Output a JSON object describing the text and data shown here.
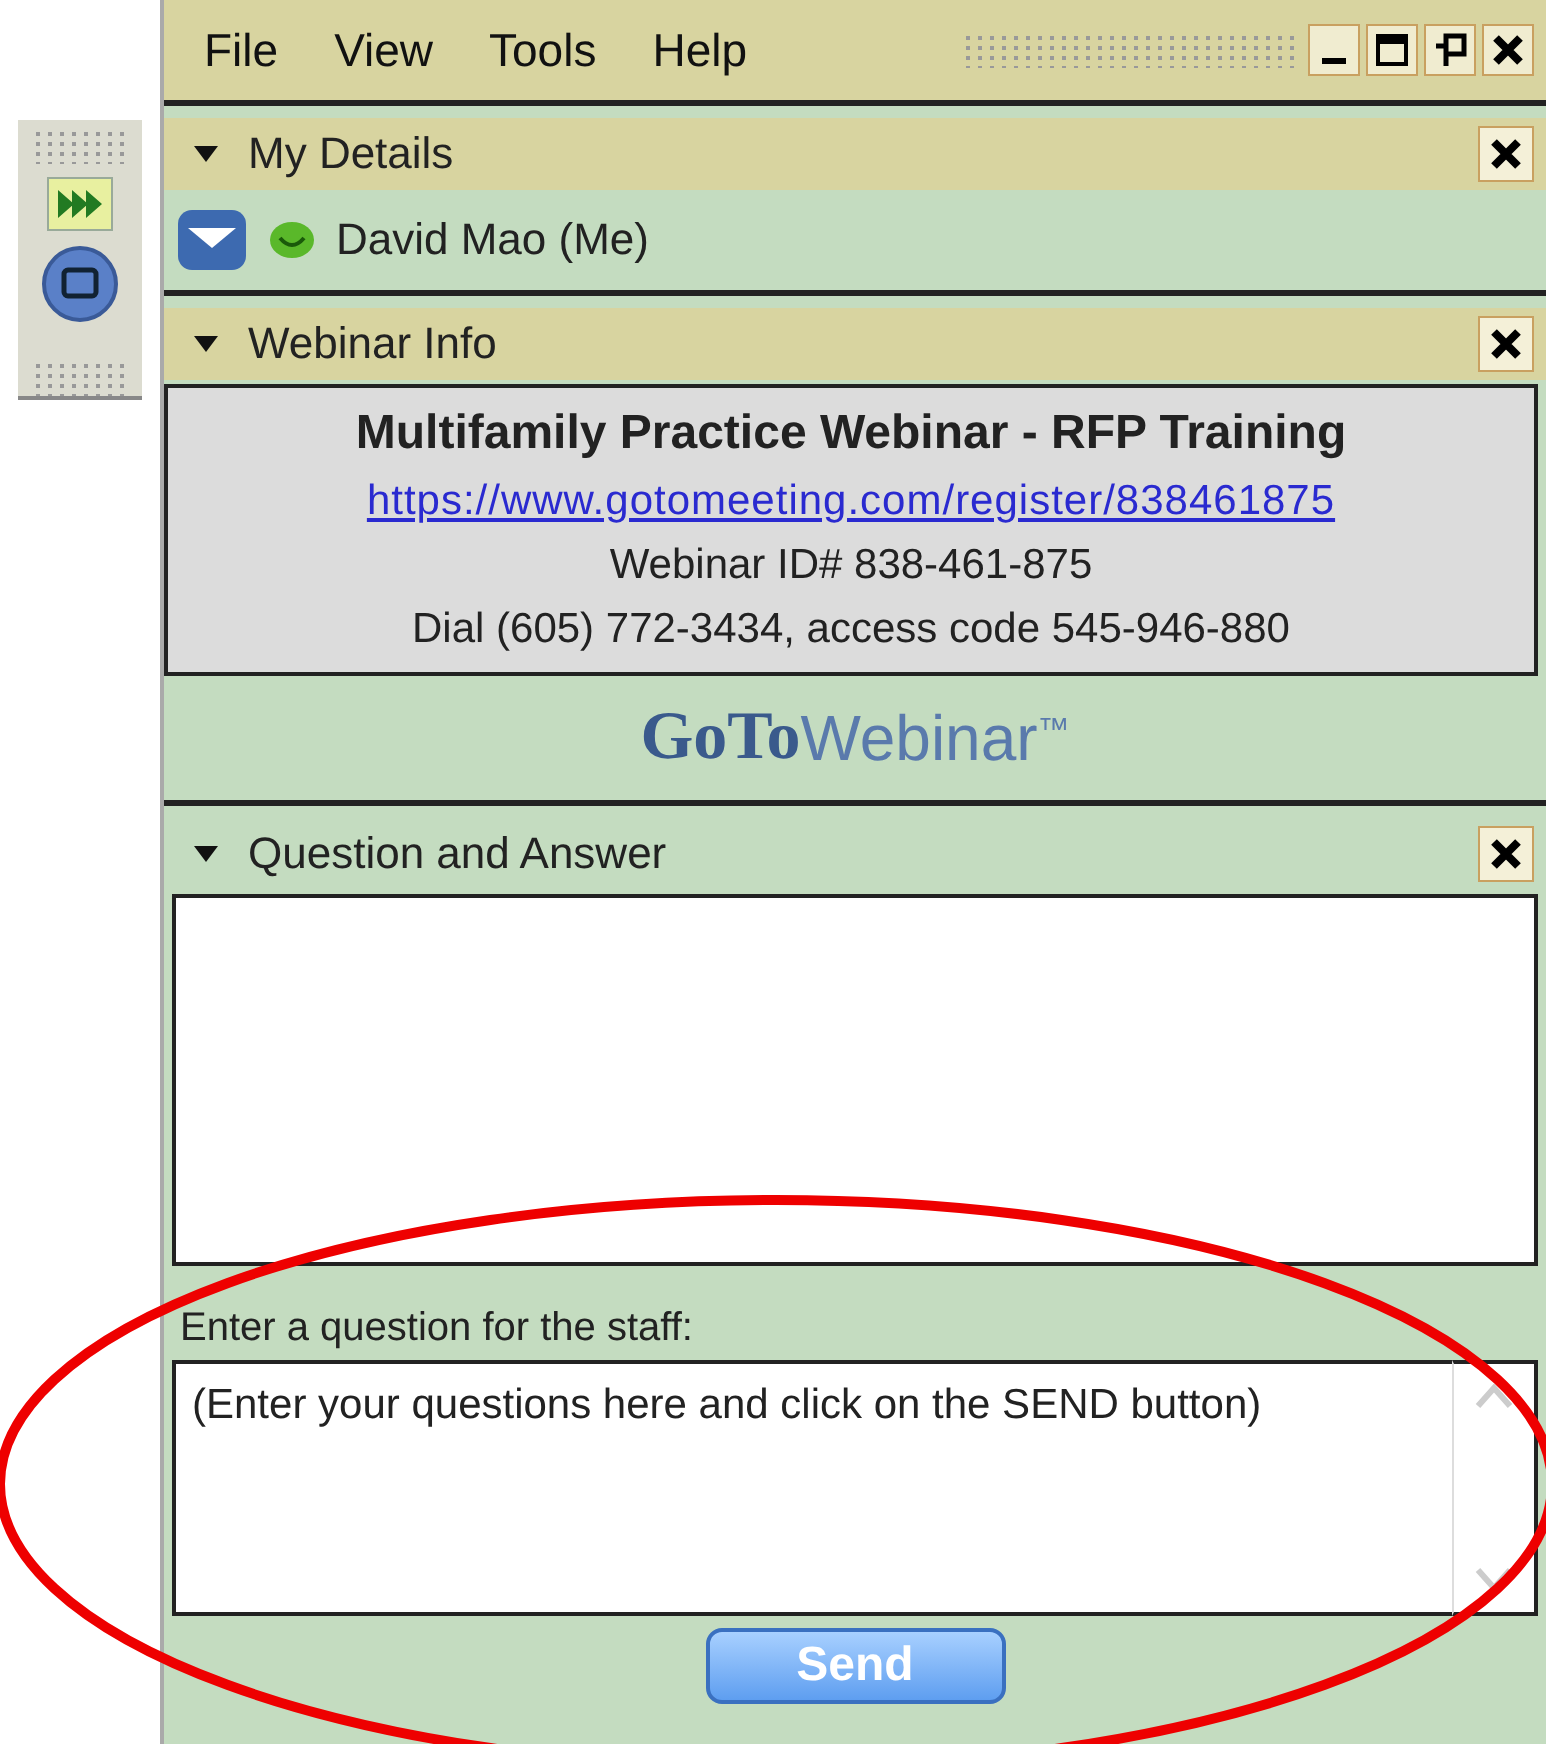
{
  "menu": [
    "File",
    "View",
    "Tools",
    "Help"
  ],
  "my_details": {
    "title": "My Details",
    "expanded": true,
    "attendee": "David Mao (Me)"
  },
  "webinar_info": {
    "title": "Webinar Info",
    "expanded": true,
    "name": "Multifamily Practice Webinar -  RFP Training",
    "link": "https://www.gotomeeting.com/register/838461875",
    "webinar_id": "Webinar ID# 838-461-875",
    "dial": "Dial (605) 772-3434, access code 545-946-880",
    "logo": {
      "bold": "GoTo",
      "light": "Webinar",
      "mark": "™"
    }
  },
  "question_and_answer": {
    "title": "Question and Answer",
    "expanded": true,
    "prompt": "Enter a question for the staff:",
    "question": "(Enter your questions here and click on the SEND button)",
    "send": "Send"
  }
}
